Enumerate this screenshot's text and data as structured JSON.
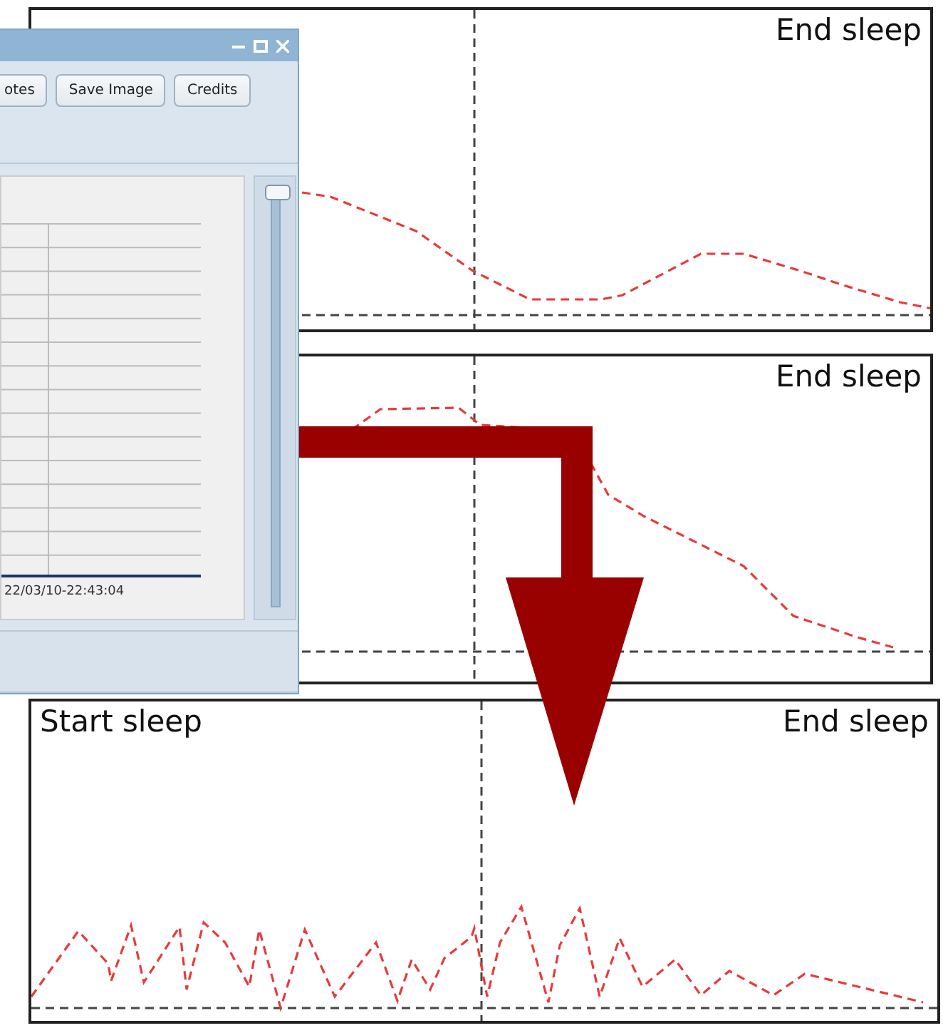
{
  "panels": [
    {
      "end_label": "End sleep"
    },
    {
      "end_label": "End sleep"
    },
    {
      "start_label": "Start sleep",
      "end_label": "End sleep"
    }
  ],
  "window": {
    "buttons": [
      "otes",
      "Save Image",
      "Credits"
    ],
    "axis_label": "22/03/10-22:43:04",
    "slider": {
      "level": 1
    }
  }
}
